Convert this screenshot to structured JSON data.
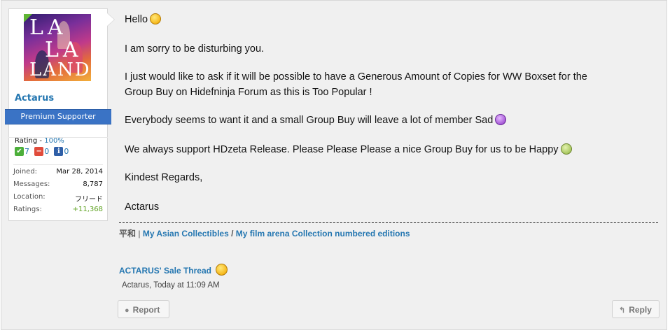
{
  "author": {
    "avatar_text": [
      "LA",
      "LA",
      "LAND"
    ],
    "username": "Actarus",
    "user_title": "Premium Supporter",
    "rating_label": "Rating -",
    "rating_pct": "100%",
    "rating_counts": {
      "positive": "7",
      "negative": "0",
      "neutral": "0"
    },
    "stats": [
      {
        "key": "Joined:",
        "value": "Mar 28, 2014"
      },
      {
        "key": "Messages:",
        "value": "8,787"
      },
      {
        "key": "Location:",
        "value": "フリード"
      },
      {
        "key": "Ratings:",
        "value": "+11,368"
      }
    ]
  },
  "message": {
    "line1": "Hello",
    "line2": "I am sorry to be disturbing you.",
    "line3a": "I just would like to ask if it will be possible to have a Generous Amount of Copies for WW Boxset for the",
    "line3b": "Group Buy on Hidefninja Forum as this is Too Popular !",
    "line4": "Everybody seems to want it and a small Group Buy will leave a lot of member Sad",
    "line5": "We always support HDzeta Release. Please Please Please a nice Group Buy for us to be Happy",
    "line6": "Kindest Regards,",
    "line7": "Actarus"
  },
  "signature": {
    "prefix": "平和",
    "sep": "|",
    "link1": "My Asian Collectibles",
    "slash": "/",
    "link2": "My film arena Collection numbered editions",
    "sale_thread": "ACTARUS' Sale Thread"
  },
  "meta": {
    "author": "Actarus,",
    "time": "Today at 11:09 AM"
  },
  "actions": {
    "report": "Report",
    "reply": "Reply"
  },
  "colors": {
    "link": "#2577b1",
    "title_bar": "#3a73c5",
    "positive": "#5fa322"
  },
  "icons": [
    "smile-icon",
    "sad-icon",
    "happy-icon",
    "report-icon",
    "reply-icon",
    "positive-rating-icon",
    "negative-rating-icon",
    "neutral-rating-icon"
  ]
}
